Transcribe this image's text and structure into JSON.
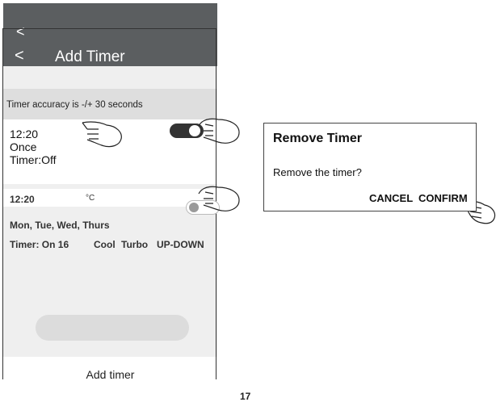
{
  "header": {
    "back_top": "<",
    "back_main": "<",
    "title": "Add Timer"
  },
  "accuracy_note": "Timer accuracy is -/+ 30 seconds",
  "timer1": {
    "time": "12:20",
    "repeat": "Once",
    "status": "Timer:Off",
    "enabled": true
  },
  "timer2": {
    "time": "12:20",
    "unit": "°C",
    "days": "Mon, Tue, Wed, Thurs",
    "timer": "Timer: On 16",
    "mode": "Cool",
    "fan": "Turbo",
    "swing": "UP-DOWN",
    "enabled": false
  },
  "add_button": "Add timer",
  "dialog": {
    "title": "Remove Timer",
    "message": "Remove the timer?",
    "cancel": "CANCEL",
    "confirm": "CONFIRM"
  },
  "page_number": "17",
  "icons": [
    "back-arrow-icon",
    "toggle-on-icon",
    "toggle-off-icon",
    "pointing-hand-icon"
  ]
}
